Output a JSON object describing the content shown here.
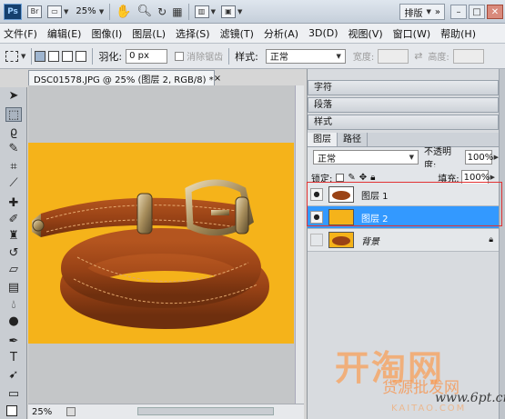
{
  "appbar": {
    "logo": "Ps",
    "bridge": "Br",
    "zoom": "25%",
    "workspace": "排版",
    "window_buttons": [
      "–",
      "□",
      "✕"
    ]
  },
  "menu": [
    "文件(F)",
    "编辑(E)",
    "图像(I)",
    "图层(L)",
    "选择(S)",
    "滤镜(T)",
    "分析(A)",
    "3D(D)",
    "视图(V)",
    "窗口(W)",
    "帮助(H)"
  ],
  "options": {
    "feather_label": "羽化:",
    "feather_value": "0 px",
    "antialias_label": "消除锯齿",
    "style_label": "样式:",
    "style_value": "正常",
    "width_label": "宽度:",
    "height_label": "高度:"
  },
  "document": {
    "tab_title": "DSC01578.JPG @ 25% (图层 2, RGB/8) *",
    "close": "×",
    "zoom_status": "25%",
    "canvas_color": "#f5b31a"
  },
  "panels": {
    "collapsed": [
      "字符",
      "段落",
      "样式"
    ],
    "tabs": [
      "图层",
      "路径"
    ],
    "blend_mode": "正常",
    "opacity_label": "不透明度:",
    "opacity_value": "100%",
    "lock_label": "锁定:",
    "fill_label": "填充:",
    "fill_value": "100%",
    "layers": [
      {
        "name": "图层 1",
        "visible": true,
        "selected": false
      },
      {
        "name": "图层 2",
        "visible": true,
        "selected": true
      },
      {
        "name": "背景",
        "visible": false,
        "selected": false
      }
    ]
  },
  "watermark": {
    "main": "开淘网",
    "sub": "货源批发网",
    "url": "www.6pt.cn",
    "brand": "KAITAO.COM"
  }
}
